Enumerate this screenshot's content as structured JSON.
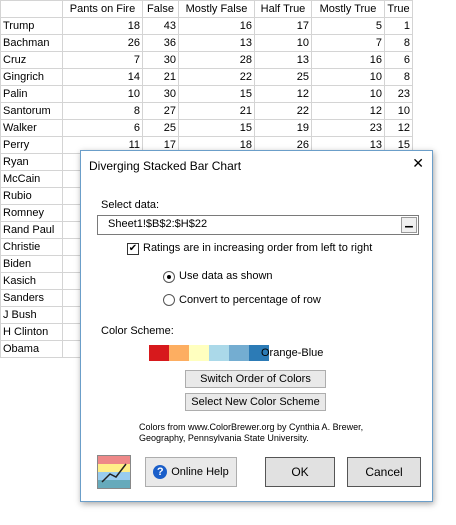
{
  "sheet": {
    "headers": [
      "",
      "Pants on Fire",
      "False",
      "Mostly False",
      "Half True",
      "Mostly True",
      "True"
    ],
    "rows": [
      [
        "Trump",
        "18",
        "43",
        "16",
        "17",
        "5",
        "1"
      ],
      [
        "Bachman",
        "26",
        "36",
        "13",
        "10",
        "7",
        "8"
      ],
      [
        "Cruz",
        "7",
        "30",
        "28",
        "13",
        "16",
        "6"
      ],
      [
        "Gingrich",
        "14",
        "21",
        "22",
        "25",
        "10",
        "8"
      ],
      [
        "Palin",
        "10",
        "30",
        "15",
        "12",
        "10",
        "23"
      ],
      [
        "Santorum",
        "8",
        "27",
        "21",
        "22",
        "12",
        "10"
      ],
      [
        "Walker",
        "6",
        "25",
        "15",
        "19",
        "23",
        "12"
      ],
      [
        "Perry",
        "11",
        "17",
        "18",
        "26",
        "13",
        "15"
      ],
      [
        "Ryan",
        "",
        "",
        "",
        "",
        "",
        ""
      ],
      [
        "McCain",
        "",
        "",
        "",
        "",
        "",
        ""
      ],
      [
        "Rubio",
        "",
        "",
        "",
        "",
        "",
        ""
      ],
      [
        "Romney",
        "",
        "",
        "",
        "",
        "",
        ""
      ],
      [
        "Rand Paul",
        "",
        "",
        "",
        "",
        "",
        ""
      ],
      [
        "Christie",
        "",
        "",
        "",
        "",
        "",
        ""
      ],
      [
        "Biden",
        "",
        "",
        "",
        "",
        "",
        ""
      ],
      [
        "Kasich",
        "",
        "",
        "",
        "",
        "",
        ""
      ],
      [
        "Sanders",
        "",
        "",
        "",
        "",
        "",
        ""
      ],
      [
        "J Bush",
        "",
        "",
        "",
        "",
        "",
        ""
      ],
      [
        "H Clinton",
        "",
        "",
        "",
        "",
        "",
        ""
      ],
      [
        "Obama",
        "",
        "",
        "",
        "",
        "",
        ""
      ]
    ]
  },
  "dialog": {
    "title": "Diverging Stacked Bar Chart",
    "close": "✕",
    "select_data_label": "Select data:",
    "range_value": "Sheet1!$B$2:$H$22",
    "range_btn": "▁",
    "increasing_check_label": "Ratings are in increasing order from left to right",
    "increasing_checked": "✔",
    "radio_use_data": "Use data as shown",
    "radio_convert": "Convert to percentage of row",
    "color_scheme_label": "Color Scheme:",
    "scheme_name": "Orange-Blue",
    "swatch_colors": [
      "#d7191c",
      "#fdae61",
      "#ffffbf",
      "#abd9e9",
      "#74add1",
      "#2c7bb6"
    ],
    "switch_order_btn": "Switch Order of Colors",
    "new_scheme_btn": "Select New Color Scheme",
    "credits": "Colors from www.ColorBrewer.org by Cynthia A. Brewer, Geography, Pennsylvania State University.",
    "help_btn": "Online Help",
    "help_icon": "?",
    "ok_btn": "OK",
    "cancel_btn": "Cancel"
  }
}
